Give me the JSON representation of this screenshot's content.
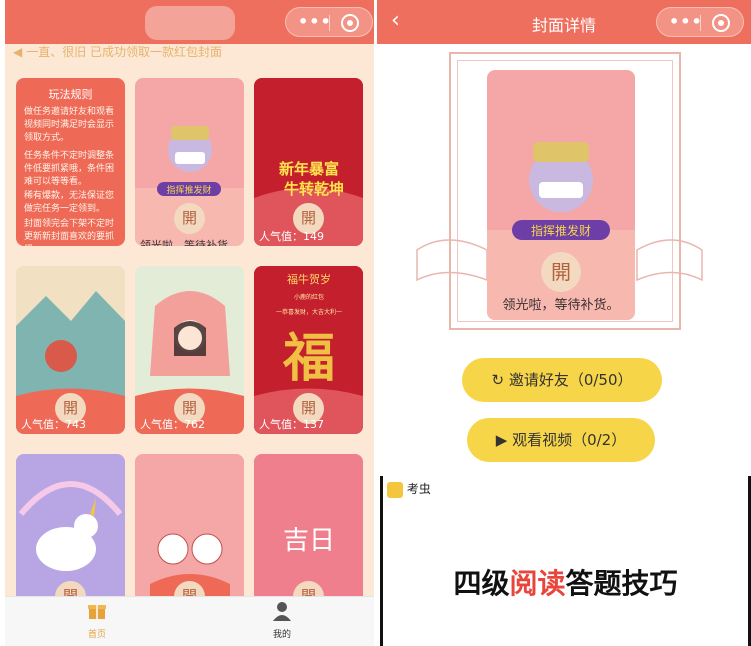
{
  "left": {
    "notice": "一直、很旧 已成功领取一款红包封面",
    "rules": {
      "title": "玩法规则",
      "paragraphs": [
        "做任务邀请好友和观看视频同时满足时会显示领取方式。",
        "任务条件不定时调整条件低要抓紧哦，条件困难可以等等看。",
        "稀有爆款，无法保证您做完任务一定领到。",
        "封面领完会下架不定时更新新封面喜欢的要抓紧。"
      ]
    },
    "open_label": "開",
    "sold_out": "领光啦，等待补货。",
    "banner_text": "指挥推发财",
    "cards": [
      {
        "art_text_1": "新年暴富",
        "art_text_2": "牛转乾坤",
        "popularity": "人气值：149"
      },
      {
        "popularity": "人气值：743"
      },
      {
        "popularity": "人气值：762"
      },
      {
        "art_text_1": "福牛贺岁",
        "art_text_2": "小鹿的红包",
        "art_text_3": "一恭喜发财，大吉大利一",
        "art_text_4": "福",
        "popularity": "人气值：137"
      },
      {
        "art_text_1": "吉日"
      }
    ],
    "tabs": [
      {
        "label": "首页",
        "color": "#e6a23c"
      },
      {
        "label": "我的",
        "color": "#333333"
      }
    ]
  },
  "right": {
    "page_title": "封面详情",
    "back_icon": "chevron-left-icon",
    "banner_text": "指挥推发财",
    "open_label": "開",
    "sold_out": "领光啦，等待补货。",
    "invite_label": "邀请好友（0/50）",
    "watch_label": "观看视频（0/2）",
    "video": {
      "channel": "考虫",
      "headline_pre": "四级",
      "headline_highlight": "阅读",
      "headline_post": "答题技巧"
    }
  },
  "colors": {
    "brand_red": "#ef6f5e",
    "button_yellow": "#f7d548",
    "highlight_red": "#e8453c"
  }
}
